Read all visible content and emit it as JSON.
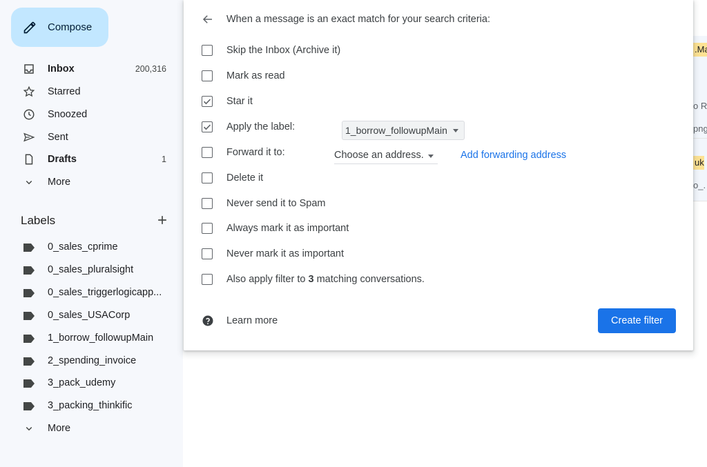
{
  "sidebar": {
    "compose_label": "Compose",
    "nav": [
      {
        "label": "Inbox",
        "count": "200,316",
        "icon": "inbox-icon"
      },
      {
        "label": "Starred",
        "count": "",
        "icon": "star-icon"
      },
      {
        "label": "Snoozed",
        "count": "",
        "icon": "clock-icon"
      },
      {
        "label": "Sent",
        "count": "",
        "icon": "send-icon"
      },
      {
        "label": "Drafts",
        "count": "1",
        "icon": "draft-icon"
      },
      {
        "label": "More",
        "count": "",
        "icon": "chevron-down-icon"
      }
    ],
    "labels_title": "Labels",
    "labels": [
      "0_sales_cprime",
      "0_sales_pluralsight",
      "0_sales_triggerlogicapp...",
      "0_sales_USACorp",
      "1_borrow_followupMain",
      "2_spending_invoice",
      "3_pack_udemy",
      "3_packing_thinkific"
    ],
    "labels_more": "More"
  },
  "filter": {
    "header": "When a message is an exact match for your search criteria:",
    "options": [
      {
        "text": "Skip the Inbox (Archive it)",
        "checked": false
      },
      {
        "text": "Mark as read",
        "checked": false
      },
      {
        "text": "Star it",
        "checked": true
      },
      {
        "text": "Apply the label:",
        "checked": true
      },
      {
        "text": "Forward it to:",
        "checked": false
      },
      {
        "text": "Delete it",
        "checked": false
      },
      {
        "text": "Never send it to Spam",
        "checked": false
      },
      {
        "text": "Always mark it as important",
        "checked": false
      },
      {
        "text": "Never mark it as important",
        "checked": false
      }
    ],
    "apply_label_value": "1_borrow_followupMain",
    "forward_placeholder": "Choose an address.",
    "add_forwarding": "Add forwarding address",
    "also_apply_prefix": "Also apply filter to ",
    "also_apply_count": "3",
    "also_apply_suffix": " matching conversations.",
    "learn_more": "Learn more",
    "create_button": "Create filter"
  },
  "background": {
    "chip1": ".Ma",
    "txt1": "o R",
    "txt2": "png",
    "chip2": "uk",
    "txt3": "o_."
  },
  "colors": {
    "accent": "#1a73e8",
    "compose_bg": "#c2e7ff",
    "sidebar_bg": "#f6f8fc",
    "label_chip": "#fde293"
  }
}
